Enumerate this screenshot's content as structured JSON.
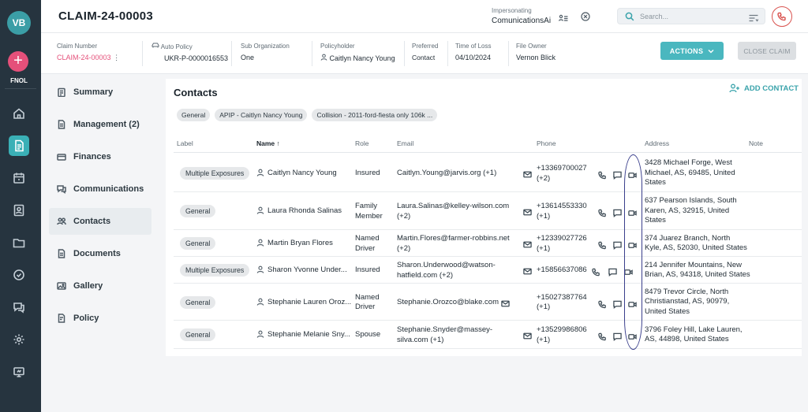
{
  "user": {
    "initials": "VB"
  },
  "rail": {
    "fnol_label": "FNOL"
  },
  "header": {
    "claim_title": "CLAIM-24-00003",
    "impersonating_label": "Impersonating",
    "impersonating_value": "ComunicationsAi",
    "search_placeholder": "Search..."
  },
  "info": {
    "claim_number_label": "Claim Number",
    "claim_number": "CLAIM-24-00003",
    "auto_policy_label": "Auto Policy",
    "auto_policy": "UKR-P-0000016553",
    "sub_org_label": "Sub Organization",
    "sub_org": "One",
    "policyholder_label": "Policyholder",
    "policyholder": "Caitlyn Nancy Young",
    "preferred_label": "Preferred",
    "preferred_value": "Contact",
    "time_of_loss_label": "Time of Loss",
    "time_of_loss": "04/10/2024",
    "file_owner_label": "File Owner",
    "file_owner": "Vernon Blick",
    "actions_label": "ACTIONS",
    "close_claim_label": "CLOSE CLAIM"
  },
  "subnav": [
    {
      "label": "Summary",
      "icon": "clipboard-icon"
    },
    {
      "label": "Management (2)",
      "icon": "document-icon"
    },
    {
      "label": "Finances",
      "icon": "wallet-icon"
    },
    {
      "label": "Communications",
      "icon": "chat-icon"
    },
    {
      "label": "Contacts",
      "icon": "people-icon"
    },
    {
      "label": "Documents",
      "icon": "document-icon"
    },
    {
      "label": "Gallery",
      "icon": "image-icon"
    },
    {
      "label": "Policy",
      "icon": "policy-icon"
    }
  ],
  "contacts": {
    "title": "Contacts",
    "add_label": "ADD CONTACT",
    "tabs": [
      "General",
      "APIP - Caitlyn Nancy Young",
      "Collision - 2011-ford-fiesta only 106k ..."
    ],
    "columns": {
      "label": "Label",
      "name": "Name",
      "role": "Role",
      "email": "Email",
      "phone": "Phone",
      "address": "Address",
      "note": "Note"
    },
    "rows": [
      {
        "label": "Multiple Exposures",
        "name": "Caitlyn Nancy Young",
        "role1": "Insured",
        "role2": "",
        "email1": "Caitlyn.Young@jarvis.org (+1)",
        "email2": "",
        "phone1": "+13369700027",
        "phone2": "(+2)",
        "addr1": "3428 Michael Forge, West",
        "addr2": "Michael, AS, 69485, United",
        "addr3": "States"
      },
      {
        "label": "General",
        "name": "Laura Rhonda Salinas",
        "role1": "Family",
        "role2": "Member",
        "email1": "Laura.Salinas@kelley-wilson.com",
        "email2": "(+2)",
        "phone1": "+13614553330",
        "phone2": "(+1)",
        "addr1": "637 Pearson Islands, South",
        "addr2": "Karen, AS, 32915, United",
        "addr3": "States"
      },
      {
        "label": "General",
        "name": "Martin Bryan Flores",
        "role1": "Named",
        "role2": "Driver",
        "email1": "Martin.Flores@farmer-robbins.net",
        "email2": "(+2)",
        "phone1": "+12339027726",
        "phone2": "(+1)",
        "addr1": "374 Juarez Branch, North",
        "addr2": "Kyle, AS, 52030, United States",
        "addr3": ""
      },
      {
        "label": "Multiple Exposures",
        "name": "Sharon Yvonne Under...",
        "role1": "Insured",
        "role2": "",
        "email1": "Sharon.Underwood@watson-",
        "email2": "hatfield.com (+2)",
        "phone1": "+15856637086",
        "phone2": "",
        "addr1": "214 Jennifer Mountains, New",
        "addr2": "Brian, AS, 94318, United States",
        "addr3": ""
      },
      {
        "label": "General",
        "name": "Stephanie Lauren Oroz...",
        "role1": "Named",
        "role2": "Driver",
        "email1": "Stephanie.Orozco@blake.com",
        "email2": "",
        "phone1": "+15027387764",
        "phone2": "(+1)",
        "addr1": "8479 Trevor Circle, North",
        "addr2": "Christianstad, AS, 90979,",
        "addr3": "United States"
      },
      {
        "label": "General",
        "name": "Stephanie Melanie Sny...",
        "role1": "Spouse",
        "role2": "",
        "email1": "Stephanie.Snyder@massey-",
        "email2": "silva.com (+1)",
        "phone1": "+13529986806",
        "phone2": "(+1)",
        "addr1": "3796 Foley Hill, Lake Lauren,",
        "addr2": "AS, 44898, United States",
        "addr3": ""
      }
    ]
  },
  "colors": {
    "accent": "#4ab7bf",
    "pink": "#e5507a",
    "rail": "#26343f",
    "annotation": "#3a3f8c"
  }
}
